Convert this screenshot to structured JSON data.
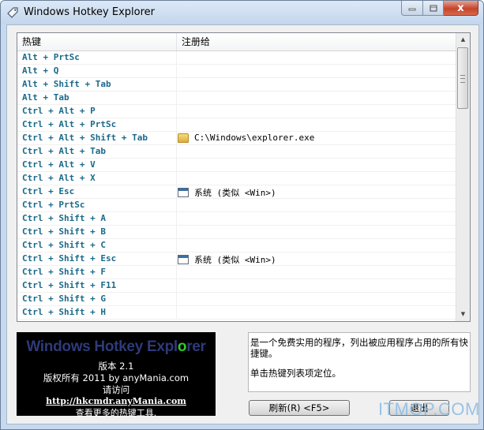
{
  "window": {
    "title": "Windows Hotkey Explorer",
    "close_glyph": "x"
  },
  "listview": {
    "columns": [
      "热键",
      "注册给"
    ],
    "rows": [
      {
        "key": "Alt + PrtSc",
        "owner": "",
        "icon": ""
      },
      {
        "key": "Alt + Q",
        "owner": "",
        "icon": ""
      },
      {
        "key": "Alt + Shift + Tab",
        "owner": "",
        "icon": ""
      },
      {
        "key": "Alt + Tab",
        "owner": "",
        "icon": ""
      },
      {
        "key": "Ctrl + Alt + P",
        "owner": "",
        "icon": ""
      },
      {
        "key": "Ctrl + Alt + PrtSc",
        "owner": "",
        "icon": ""
      },
      {
        "key": "Ctrl + Alt + Shift + Tab",
        "owner": "C:\\Windows\\explorer.exe",
        "icon": "folder-icon"
      },
      {
        "key": "Ctrl + Alt + Tab",
        "owner": "",
        "icon": ""
      },
      {
        "key": "Ctrl + Alt + V",
        "owner": "",
        "icon": ""
      },
      {
        "key": "Ctrl + Alt + X",
        "owner": "",
        "icon": ""
      },
      {
        "key": "Ctrl + Esc",
        "owner": "系统 (类似 <Win>)",
        "icon": "window-icon"
      },
      {
        "key": "Ctrl + PrtSc",
        "owner": "",
        "icon": ""
      },
      {
        "key": "Ctrl + Shift + A",
        "owner": "",
        "icon": ""
      },
      {
        "key": "Ctrl + Shift + B",
        "owner": "",
        "icon": ""
      },
      {
        "key": "Ctrl + Shift + C",
        "owner": "",
        "icon": ""
      },
      {
        "key": "Ctrl + Shift + Esc",
        "owner": "系统 (类似 <Win>)",
        "icon": "window-icon"
      },
      {
        "key": "Ctrl + Shift + F",
        "owner": "",
        "icon": ""
      },
      {
        "key": "Ctrl + Shift + F11",
        "owner": "",
        "icon": ""
      },
      {
        "key": "Ctrl + Shift + G",
        "owner": "",
        "icon": ""
      },
      {
        "key": "Ctrl + Shift + H",
        "owner": "",
        "icon": ""
      }
    ]
  },
  "banner": {
    "logo_before": "Windows Hotkey Expl",
    "logo_o": "o",
    "logo_after": "rer",
    "version": "版本 2.1",
    "copyright": "版权所有 2011 by anyMania.com",
    "visit": "请访问",
    "link": "http://hkcmdr.anyMania.com",
    "more": "查看更多的热键工具."
  },
  "info": {
    "description": "是一个免费实用的程序，列出被应用程序占用的所有快捷键。",
    "hint": "单击热键列表项定位。"
  },
  "buttons": {
    "refresh": "刷新(R) <F5>",
    "exit": "退出"
  },
  "watermark": "ITMOP.COM",
  "colors": {
    "hotkey_text": "#1a6a8a",
    "logo_o": "#2ecb2e",
    "logo_text": "#2e3a7a"
  }
}
